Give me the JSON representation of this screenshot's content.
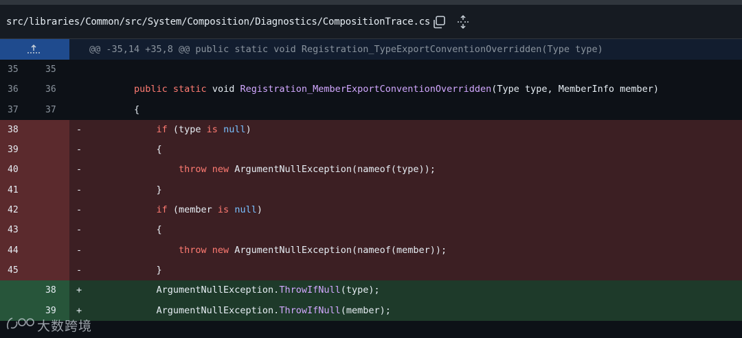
{
  "header": {
    "file_path": "src/libraries/Common/src/System/Composition/Diagnostics/CompositionTrace.cs",
    "copy_icon": "copy-icon",
    "expand_icon": "expand-all-icon"
  },
  "hunk": {
    "expand_icon": "expand-up-icon",
    "text": "@@ -35,14 +35,8 @@ public static void Registration_TypeExportConventionOverridden(Type type)"
  },
  "lines": [
    {
      "type": "ctx",
      "old": "35",
      "new": "35",
      "marker": "",
      "tokens": []
    },
    {
      "type": "ctx",
      "old": "36",
      "new": "36",
      "marker": "",
      "indent": 2,
      "tokens": [
        {
          "t": "public ",
          "c": "kw"
        },
        {
          "t": "static ",
          "c": "kw"
        },
        {
          "t": "void ",
          "c": ""
        },
        {
          "t": "Registration_MemberExportConventionOverridden",
          "c": "fn"
        },
        {
          "t": "(Type type, MemberInfo member)",
          "c": ""
        }
      ]
    },
    {
      "type": "ctx",
      "old": "37",
      "new": "37",
      "marker": "",
      "indent": 2,
      "tokens": [
        {
          "t": "{",
          "c": ""
        }
      ]
    },
    {
      "type": "del",
      "old": "38",
      "new": "",
      "marker": "-",
      "indent": 3,
      "tokens": [
        {
          "t": "if ",
          "c": "kw"
        },
        {
          "t": "(type ",
          "c": ""
        },
        {
          "t": "is ",
          "c": "kw"
        },
        {
          "t": "null",
          "c": "kw2"
        },
        {
          "t": ")",
          "c": ""
        }
      ]
    },
    {
      "type": "del",
      "old": "39",
      "new": "",
      "marker": "-",
      "indent": 3,
      "tokens": [
        {
          "t": "{",
          "c": ""
        }
      ]
    },
    {
      "type": "del",
      "old": "40",
      "new": "",
      "marker": "-",
      "indent": 4,
      "tokens": [
        {
          "t": "throw ",
          "c": "kw"
        },
        {
          "t": "new ",
          "c": "kw"
        },
        {
          "t": "ArgumentNullException",
          "c": ""
        },
        {
          "t": "(nameof(type));",
          "c": ""
        }
      ]
    },
    {
      "type": "del",
      "old": "41",
      "new": "",
      "marker": "-",
      "indent": 3,
      "tokens": [
        {
          "t": "}",
          "c": ""
        }
      ]
    },
    {
      "type": "del",
      "old": "42",
      "new": "",
      "marker": "-",
      "indent": 3,
      "tokens": [
        {
          "t": "if ",
          "c": "kw"
        },
        {
          "t": "(member ",
          "c": ""
        },
        {
          "t": "is ",
          "c": "kw"
        },
        {
          "t": "null",
          "c": "kw2"
        },
        {
          "t": ")",
          "c": ""
        }
      ]
    },
    {
      "type": "del",
      "old": "43",
      "new": "",
      "marker": "-",
      "indent": 3,
      "tokens": [
        {
          "t": "{",
          "c": ""
        }
      ]
    },
    {
      "type": "del",
      "old": "44",
      "new": "",
      "marker": "-",
      "indent": 4,
      "tokens": [
        {
          "t": "throw ",
          "c": "kw"
        },
        {
          "t": "new ",
          "c": "kw"
        },
        {
          "t": "ArgumentNullException",
          "c": ""
        },
        {
          "t": "(nameof(member));",
          "c": ""
        }
      ]
    },
    {
      "type": "del",
      "old": "45",
      "new": "",
      "marker": "-",
      "indent": 3,
      "tokens": [
        {
          "t": "}",
          "c": ""
        }
      ]
    },
    {
      "type": "add",
      "old": "",
      "new": "38",
      "marker": "+",
      "indent": 3,
      "tokens": [
        {
          "t": "ArgumentNullException.",
          "c": ""
        },
        {
          "t": "ThrowIfNull",
          "c": "fn"
        },
        {
          "t": "(type);",
          "c": ""
        }
      ]
    },
    {
      "type": "add",
      "old": "",
      "new": "39",
      "marker": "+",
      "indent": 3,
      "tokens": [
        {
          "t": "ArgumentNullException.",
          "c": ""
        },
        {
          "t": "ThrowIfNull",
          "c": "fn"
        },
        {
          "t": "(member);",
          "c": ""
        }
      ]
    }
  ],
  "watermark": {
    "text": "大数跨境",
    "logo_icon": "watermark-logo-icon"
  },
  "colors": {
    "background": "#0d1117",
    "header_bg": "#161b22",
    "hunk_bg": "#121d2f",
    "expander_bg": "#1f4b8e",
    "deletion_bg": "#3c1f23",
    "deletion_gutter": "#5b2a2d",
    "addition_bg": "#1e3a2a",
    "addition_gutter": "#27553a",
    "keyword": "#ff7b72",
    "constant": "#79c0ff"
  }
}
